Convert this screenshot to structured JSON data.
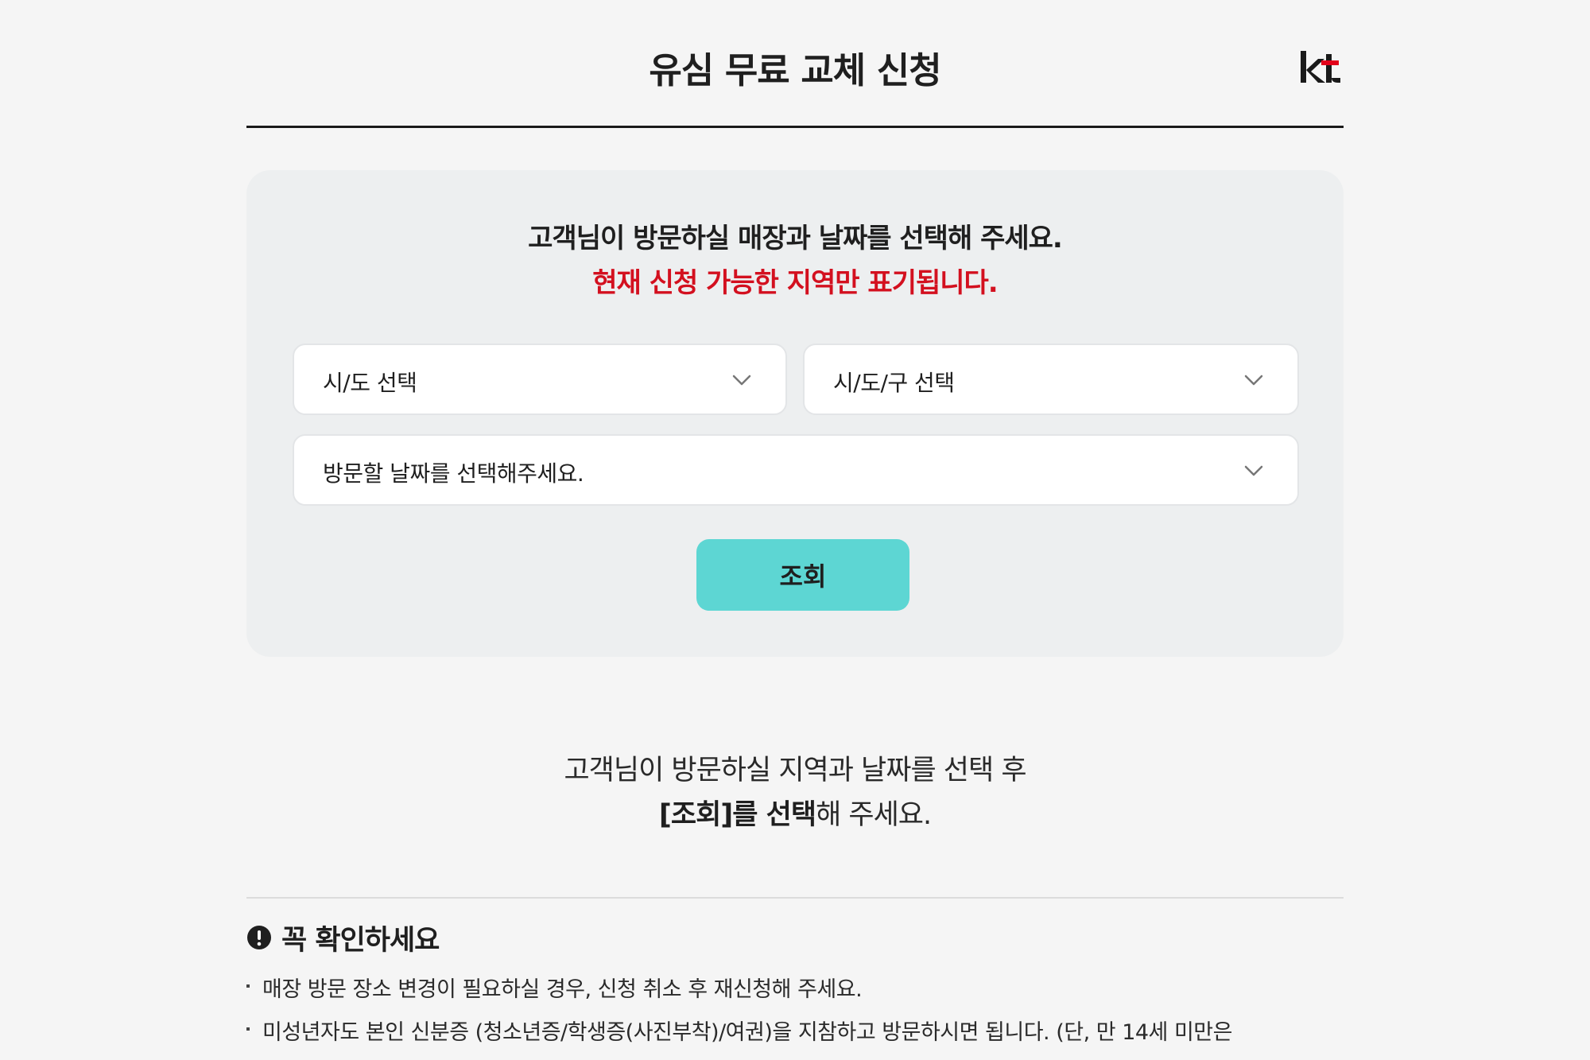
{
  "header": {
    "title": "유심 무료 교체 신청",
    "logo_text": "kt",
    "logo_colors": {
      "text": "#1a1a1a",
      "accent": "#e2001a"
    }
  },
  "panel": {
    "heading": "고객님이 방문하실 매장과 날짜를 선택해 주세요.",
    "notice": "현재 신청 가능한 지역만 표기됩니다.",
    "notice_color": "#d3101f",
    "dropdowns": {
      "sido": {
        "value": "시/도 선택",
        "icon": "chevron-down-icon"
      },
      "gu": {
        "value": "시/도/구 선택",
        "icon": "chevron-down-icon"
      },
      "date": {
        "value": "방문할 날짜를 선택해주세요.",
        "icon": "chevron-down-icon"
      }
    },
    "search_button": {
      "label": "조회",
      "color": "#5dd6d3"
    }
  },
  "guide": {
    "line1": "고객님이 방문하실 지역과 날짜를 선택 후",
    "line2_bold": "[조회]를 선택",
    "line2_rest": "해 주세요."
  },
  "notice_section": {
    "icon": "exclamation-circle-icon",
    "title": "꼭 확인하세요",
    "items": [
      "매장 방문 장소 변경이 필요하실 경우, 신청 취소 후 재신청해 주세요.",
      "미성년자도 본인 신분증 (청소년증/학생증(사진부착)/여권)을 지참하고 방문하시면 됩니다. (단, 만 14세 미만은"
    ]
  }
}
